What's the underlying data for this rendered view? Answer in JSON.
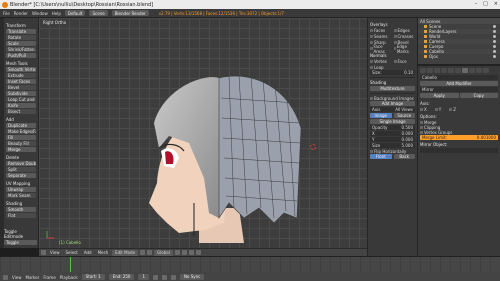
{
  "window": {
    "title": "Blender* [C:\\Users\\nulliu\\Desktop\\Rossian\\Rossian.blend]",
    "controls": [
      "–",
      "□",
      "×"
    ]
  },
  "infobar": {
    "menus": [
      "File",
      "Render",
      "Window",
      "Help"
    ],
    "layout": "Default",
    "scene": "Scene",
    "engine": "Blender Render",
    "stats": "v2.79 | Verts:13/1568 | Faces:12/1536 | Tris:3072 | Objects:1/7"
  },
  "toolshelf": {
    "groups": [
      {
        "header": "Transform",
        "buttons": [
          "Translate",
          "Rotate",
          "Scale",
          "Shrink/Fatten",
          "Push/Pull"
        ]
      },
      {
        "header": "Mesh Tools",
        "buttons": [
          "Smooth Vertex",
          "Extrude",
          "Inset Faces",
          "Bevel",
          "Subdivide",
          "Loop Cut and Slide",
          "Knife",
          "Bisect"
        ]
      },
      {
        "header": "Add",
        "buttons": [
          "Duplicate",
          "Make Edges/Faces",
          "Fill",
          "Beauty Fill",
          "Merge"
        ]
      },
      {
        "header": "Delete",
        "buttons": [
          "Remove Doubles",
          "Split",
          "Separate"
        ]
      },
      {
        "header": "UV Mapping",
        "buttons": [
          "Unwrap",
          "Mark Seam"
        ]
      },
      {
        "header": "Shading",
        "buttons": [
          "Smooth",
          "Flat"
        ]
      }
    ],
    "bottom_header": "Toggle Editmode",
    "bottom_field": "Toggle"
  },
  "viewport": {
    "label": "Right Ortho",
    "object_label": "(1) Cabello"
  },
  "vp_header": {
    "menus": [
      "View",
      "Select",
      "Add",
      "Mesh"
    ],
    "mode": "Edit Mode",
    "pivot": "Global"
  },
  "npanel": {
    "display_header": "Overlays",
    "overlays": [
      "Faces",
      "Edges",
      "Seams",
      "Creases",
      "Sharp",
      "Bevel",
      "Face Areas",
      "Edge Marks"
    ],
    "normals_header": "Normals",
    "normals": [
      "Vertex",
      "Face",
      "Loop"
    ],
    "size_label": "Size:",
    "size_value": "0.10",
    "shading_header": "Shading",
    "shading_value": "Multitexture",
    "background_header": "Background Images",
    "bg_add_button": "Add Image",
    "image_label": "Image",
    "source_label": "Source",
    "source_value": "Single Image",
    "axis_label": "Axis",
    "axis_value": "All Views",
    "opacity_label": "Opacity",
    "opacity_value": "0.500",
    "x_label": "X",
    "x_value": "0.000",
    "y_label": "Y",
    "y_value": "0.000",
    "size2_label": "Size",
    "size2_value": "5.000",
    "flip_label": "Flip Horizontally",
    "front_button": "Front",
    "back_button": "Back"
  },
  "outliner": {
    "header": "All Scenes",
    "rows": [
      "Scene",
      "RenderLayers",
      "World",
      "Camera",
      "Cuerpo",
      "Cabello",
      "Ojos"
    ]
  },
  "properties": {
    "object_name": "Cabello",
    "modifiers_header": "Add Modifier",
    "modifier_name": "Mirror",
    "axis_header": "Axis:",
    "axes": [
      "X",
      "Y",
      "Z"
    ],
    "options_header": "Options:",
    "options": [
      "Merge",
      "Clipping",
      "Vertex Groups"
    ],
    "merge_limit_label": "Merge Limit:",
    "merge_limit_value": "0.001000",
    "mirror_object_label": "Mirror Object:",
    "apply_button": "Apply",
    "copy_button": "Copy"
  },
  "timeline": {
    "menus": [
      "View",
      "Marker",
      "Frame",
      "Playback"
    ],
    "start_label": "Start:",
    "start_value": "1",
    "end_label": "End:",
    "end_value": "250",
    "current_value": "1",
    "sync": "No Sync"
  }
}
